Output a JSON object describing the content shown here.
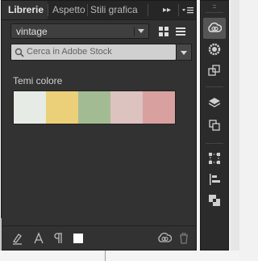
{
  "tabs": [
    {
      "label": "Librerie",
      "active": true
    },
    {
      "label": "Aspetto",
      "active": false
    },
    {
      "label": "Stili grafica",
      "active": false
    }
  ],
  "tabbar": {
    "collapse_icon": "double-chevron-right-icon",
    "menu_icon": "panel-menu-icon"
  },
  "library_select": {
    "value": "vintage"
  },
  "view_toggles": {
    "grid_icon": "grid-view-icon",
    "list_icon": "list-view-icon",
    "active": "grid"
  },
  "search": {
    "placeholder": "Cerca in Adobe Stock",
    "value": "",
    "dropdown_icon": "chevron-down-icon"
  },
  "color_themes": {
    "title": "Temi colore",
    "swatches": [
      "#e6ebe5",
      "#eccf79",
      "#a3bb93",
      "#dcc3c0",
      "#d9a0a0"
    ]
  },
  "bottom_bar": {
    "icons": [
      "add-graphic-icon",
      "add-character-style-icon",
      "add-paragraph-style-icon",
      "add-color-icon",
      "creative-cloud-sync-icon",
      "trash-icon"
    ]
  },
  "side_toolbar": {
    "icons": [
      "creative-cloud-libraries-icon",
      "color-wheel-icon",
      "artboard-icon",
      "layers-icon",
      "pages-icon",
      "transform-icon",
      "align-icon",
      "pathfinder-icon"
    ]
  }
}
